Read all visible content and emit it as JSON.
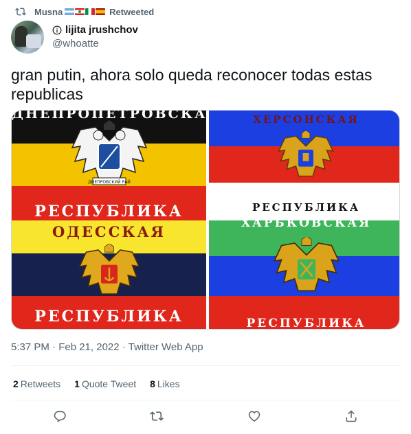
{
  "retweet_bar": {
    "user": "Musna",
    "flags": [
      "argentina-flag",
      "lebanon-flag",
      "italy-flag",
      "spain-flag"
    ],
    "label": "Retweeted"
  },
  "author": {
    "display_name": "lijita jrushchov",
    "handle": "@whoatte"
  },
  "tweet": {
    "text": "gran putin, ahora solo queda reconocer todas estas republicas",
    "timestamp": "5:37 PM · Feb 21, 2022 · Twitter Web App"
  },
  "media": {
    "flags": [
      {
        "title": "ДНЕПРОПЕТРОВСКАЯ",
        "subtitle": "РЕСПУБЛИКА",
        "emblem_text": "ДНЕПРОВСКИЙ РАЙ",
        "colors": [
          "#111111",
          "#f4c300",
          "#e1261c"
        ]
      },
      {
        "title": "ХЕРСОНСКАЯ",
        "subtitle": "РЕСПУБЛИКА",
        "colors": [
          "#1b3fe0",
          "#e1261c",
          "#ffffff"
        ]
      },
      {
        "title": "ОДЕССКАЯ",
        "subtitle": "РЕСПУБЛИКА",
        "colors": [
          "#f7e52e",
          "#17214d",
          "#e1261c"
        ]
      },
      {
        "title": "ХАРЬКОВСКАЯ",
        "subtitle": "РЕСПУБЛИКА",
        "colors": [
          "#3fb55b",
          "#1b3fe0",
          "#e1261c"
        ]
      }
    ]
  },
  "stats": {
    "retweets": {
      "count": "2",
      "label": "Retweets"
    },
    "quotes": {
      "count": "1",
      "label": "Quote Tweet"
    },
    "likes": {
      "count": "8",
      "label": "Likes"
    }
  },
  "actions": [
    "reply-icon",
    "retweet-icon",
    "like-icon",
    "share-icon"
  ],
  "colors": {
    "secondary_text": "#536471",
    "primary_text": "#0f1419",
    "divider": "#eff3f4"
  }
}
